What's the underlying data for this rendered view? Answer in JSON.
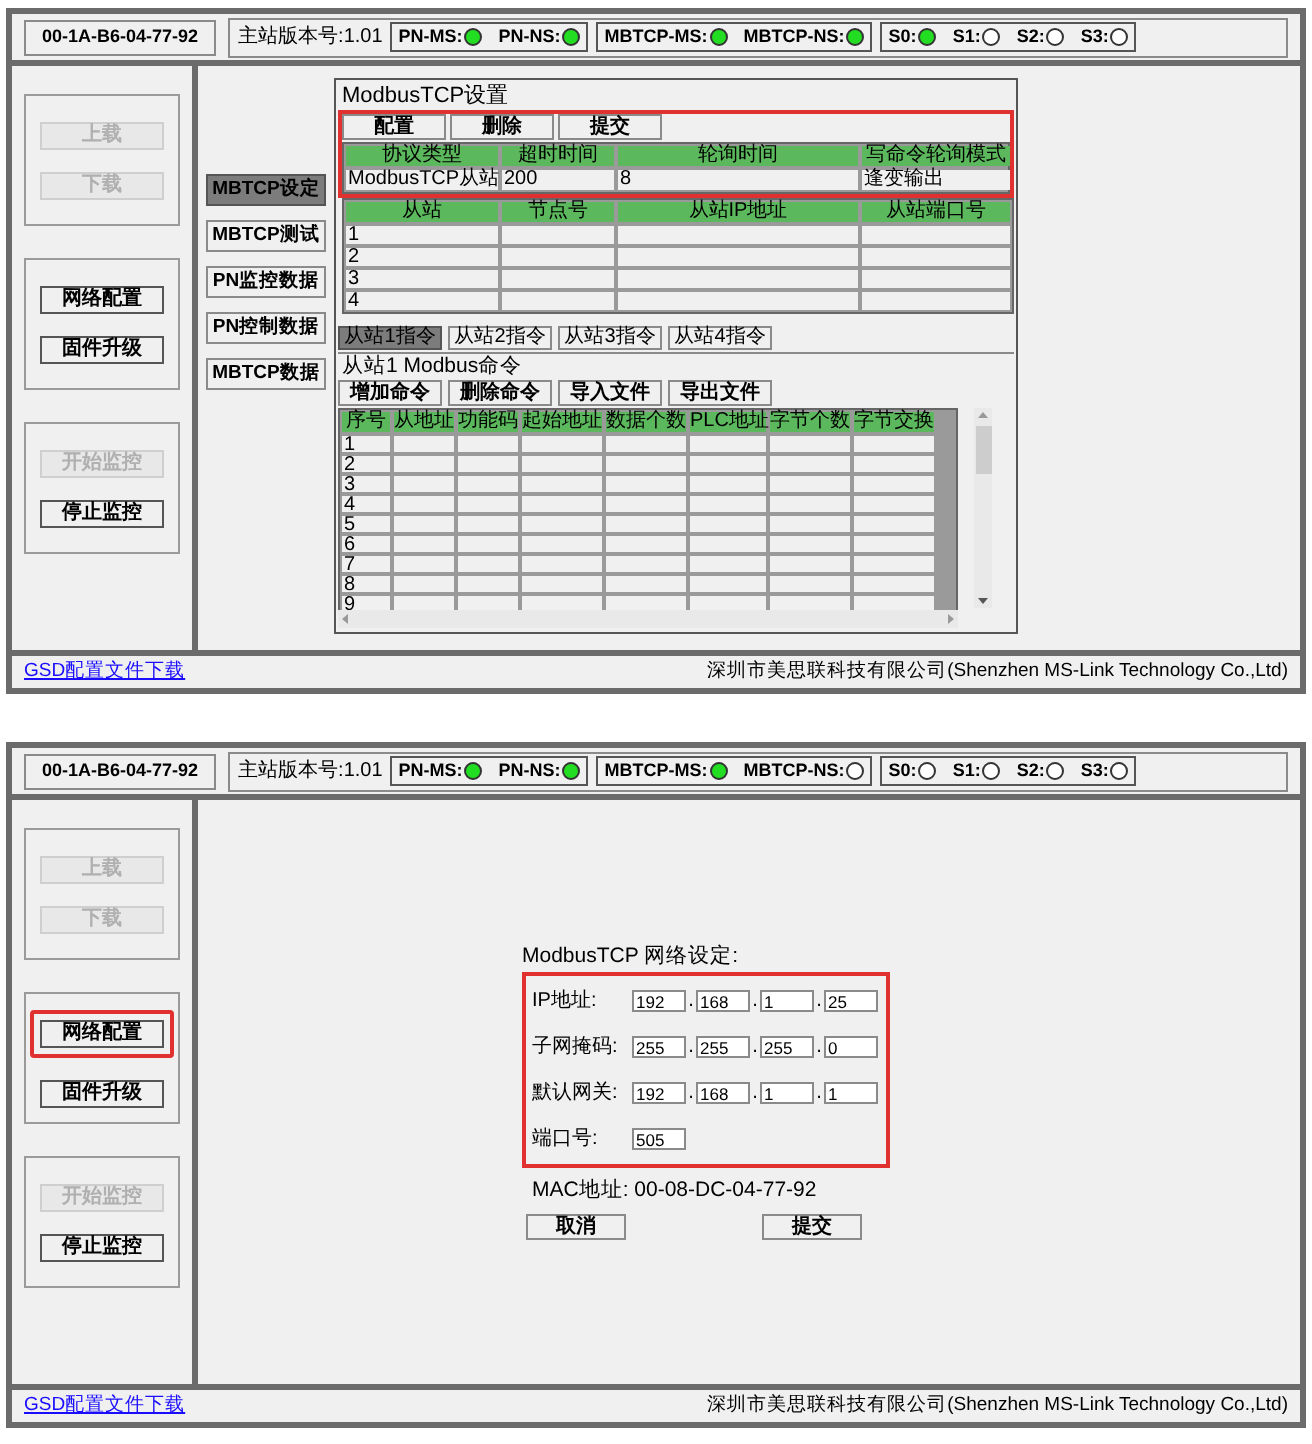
{
  "screens": [
    {
      "header": {
        "mac": "00-1A-B6-04-77-92",
        "version": "主站版本号:1.01",
        "status_groups": [
          {
            "indicators": [
              {
                "label": "PN-MS:",
                "on": true
              },
              {
                "label": "PN-NS:",
                "on": true
              }
            ]
          },
          {
            "indicators": [
              {
                "label": "MBTCP-MS:",
                "on": true
              },
              {
                "label": "MBTCP-NS:",
                "on": true
              }
            ]
          },
          {
            "indicators": [
              {
                "label": "S0:",
                "on": true
              },
              {
                "label": "S1:",
                "on": false
              },
              {
                "label": "S2:",
                "on": false
              },
              {
                "label": "S3:",
                "on": false
              }
            ]
          }
        ]
      },
      "sidebar_groups": [
        {
          "buttons": [
            {
              "label": "上载",
              "disabled": true,
              "highlighted": false
            },
            {
              "label": "下载",
              "disabled": true,
              "highlighted": false
            }
          ]
        },
        {
          "buttons": [
            {
              "label": "网络配置",
              "disabled": false,
              "highlighted": false
            },
            {
              "label": "固件升级",
              "disabled": false,
              "highlighted": false
            }
          ]
        },
        {
          "buttons": [
            {
              "label": "开始监控",
              "disabled": true,
              "highlighted": false
            },
            {
              "label": "停止监控",
              "disabled": false,
              "highlighted": false
            }
          ]
        }
      ],
      "main": {
        "kind": "modbus_settings",
        "nav_tabs": [
          {
            "label": "MBTCP设定",
            "selected": true
          },
          {
            "label": "MBTCP测试",
            "selected": false
          },
          {
            "label": "PN监控数据",
            "selected": false
          },
          {
            "label": "PN控制数据",
            "selected": false
          },
          {
            "label": "MBTCP数据",
            "selected": false
          }
        ],
        "panel": {
          "title": "ModbusTCP设置",
          "highlighted": true,
          "buttons": [
            "配置",
            "删除",
            "提交"
          ],
          "protocol_table": {
            "columns": [
              "协议类型",
              "超时时间",
              "轮询时间",
              "写命令轮询模式"
            ],
            "rows": [
              [
                "ModbusTCP从站",
                "200",
                "8",
                "逢变输出"
              ]
            ]
          },
          "slave_table": {
            "columns": [
              "从站",
              "节点号",
              "从站IP地址",
              "从站端口号"
            ],
            "rows": [
              [
                "1",
                "",
                "",
                ""
              ],
              [
                "2",
                "",
                "",
                ""
              ],
              [
                "3",
                "",
                "",
                ""
              ],
              [
                "4",
                "",
                "",
                ""
              ]
            ]
          },
          "slave_tabs": [
            {
              "label": "从站1指令",
              "selected": true
            },
            {
              "label": "从站2指令",
              "selected": false
            },
            {
              "label": "从站3指令",
              "selected": false
            },
            {
              "label": "从站4指令",
              "selected": false
            }
          ],
          "command_title": "从站1 Modbus命令",
          "command_buttons": [
            "增加命令",
            "删除命令",
            "导入文件",
            "导出文件"
          ],
          "command_table": {
            "columns": [
              "序号",
              "从地址",
              "功能码",
              "起始地址",
              "数据个数",
              "PLC地址",
              "字节个数",
              "字节交换"
            ],
            "rows": [
              [
                "1"
              ],
              [
                "2"
              ],
              [
                "3"
              ],
              [
                "4"
              ],
              [
                "5"
              ],
              [
                "6"
              ],
              [
                "7"
              ],
              [
                "8"
              ],
              [
                "9"
              ]
            ]
          }
        }
      },
      "footer": {
        "link": "GSD配置文件下载",
        "company": "深圳市美思联科技有限公司(Shenzhen MS-Link Technology Co.,Ltd)"
      }
    },
    {
      "header": {
        "mac": "00-1A-B6-04-77-92",
        "version": "主站版本号:1.01",
        "status_groups": [
          {
            "indicators": [
              {
                "label": "PN-MS:",
                "on": true
              },
              {
                "label": "PN-NS:",
                "on": true
              }
            ]
          },
          {
            "indicators": [
              {
                "label": "MBTCP-MS:",
                "on": true
              },
              {
                "label": "MBTCP-NS:",
                "on": false
              }
            ]
          },
          {
            "indicators": [
              {
                "label": "S0:",
                "on": false
              },
              {
                "label": "S1:",
                "on": false
              },
              {
                "label": "S2:",
                "on": false
              },
              {
                "label": "S3:",
                "on": false
              }
            ]
          }
        ]
      },
      "sidebar_groups": [
        {
          "buttons": [
            {
              "label": "上载",
              "disabled": true,
              "highlighted": false
            },
            {
              "label": "下载",
              "disabled": true,
              "highlighted": false
            }
          ]
        },
        {
          "buttons": [
            {
              "label": "网络配置",
              "disabled": false,
              "highlighted": true
            },
            {
              "label": "固件升级",
              "disabled": false,
              "highlighted": false
            }
          ]
        },
        {
          "buttons": [
            {
              "label": "开始监控",
              "disabled": true,
              "highlighted": false
            },
            {
              "label": "停止监控",
              "disabled": false,
              "highlighted": false
            }
          ]
        }
      ],
      "main": {
        "kind": "network_settings",
        "title": "ModbusTCP 网络设定:",
        "highlighted": true,
        "fields": [
          {
            "label": "IP地址:",
            "separator": ".",
            "values": [
              "192",
              "168",
              "1",
              "25"
            ]
          },
          {
            "label": "子网掩码:",
            "separator": ".",
            "values": [
              "255",
              "255",
              "255",
              "0"
            ]
          },
          {
            "label": "默认网关:",
            "separator": ".",
            "values": [
              "192",
              "168",
              "1",
              "1"
            ]
          },
          {
            "label": "端口号:",
            "values": [
              "505"
            ]
          }
        ],
        "mac": "MAC地址:  00-08-DC-04-77-92",
        "buttons": [
          "取消",
          "提交"
        ]
      },
      "footer": {
        "link": "GSD配置文件下载",
        "company": "深圳市美思联科技有限公司(Shenzhen MS-Link Technology Co.,Ltd)"
      }
    }
  ]
}
